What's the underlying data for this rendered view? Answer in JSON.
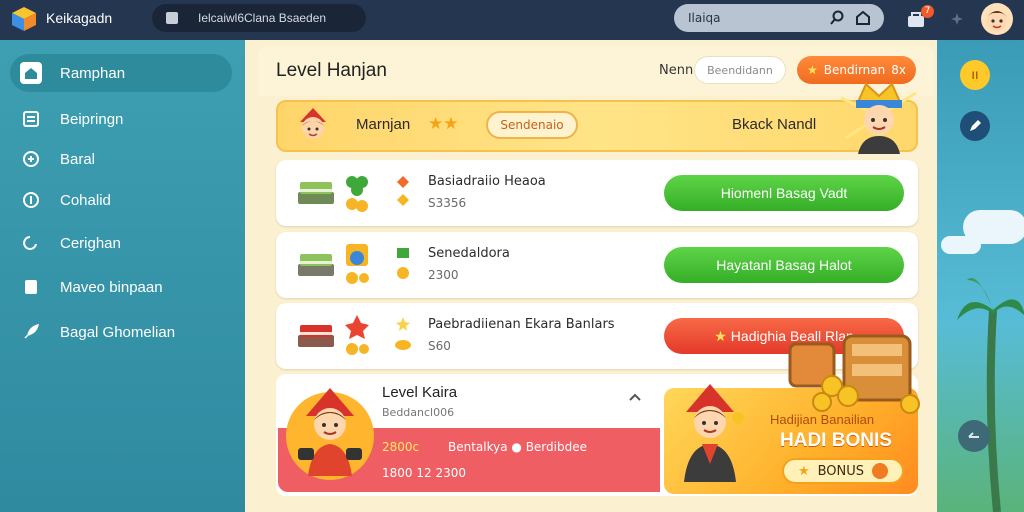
{
  "app": {
    "name": "Keikagadn",
    "tab": "Ielcaiwl6Clana Bsaeden"
  },
  "search": {
    "value": "Ilaiqa"
  },
  "header": {
    "badge_count": "7"
  },
  "sidebar": {
    "items": [
      {
        "label": "Ramphan",
        "icon": "home-icon",
        "active": true
      },
      {
        "label": "Beipringn",
        "icon": "list-icon"
      },
      {
        "label": "Baral",
        "icon": "gift-icon"
      },
      {
        "label": "Cohalid",
        "icon": "info-icon"
      },
      {
        "label": "Cerighan",
        "icon": "refresh-icon"
      },
      {
        "label": "Maveo binpaan",
        "icon": "note-icon"
      },
      {
        "label": "Bagal Ghomelian",
        "icon": "rocket-icon"
      }
    ]
  },
  "main": {
    "title": "Level Hanjan",
    "name_label": "Nenn",
    "name_placeholder": "Beendidann",
    "header_button": "Bendirnan",
    "header_button_suffix": "8x",
    "banner": {
      "name": "Marnjan",
      "stars": "★★",
      "button": "Sendenaio",
      "right_text": "Bkack Nandl"
    },
    "rows": [
      {
        "title": "Basiadraiio Heaoa",
        "value": "S3356",
        "button": "Hiomenl Basag Vadt",
        "style": "green"
      },
      {
        "title": "Senedaldora",
        "value": "2300",
        "button": "Hayatanl Basag Halot",
        "style": "green"
      },
      {
        "title": "Paebradiienan Ekara Banlars",
        "value": "S60",
        "button": "Hadighia Beall Rlan",
        "style": "red"
      }
    ],
    "level_card": {
      "title": "Level Kaira",
      "subtitle": "Beddancl006",
      "line1_highlight": "2800c",
      "line1_text": "Bentalkya ● Berdibdee",
      "line2": "1800 12 2300"
    },
    "bonus_card": {
      "subtitle": "Hadijian Banailian",
      "title": "HADI BONIS",
      "button": "BONUS"
    }
  },
  "colors": {
    "topbar": "#243650",
    "sidebar": "#3e9fb2",
    "panel": "#fbf0cf",
    "green": "#3bb42e",
    "red": "#e94530",
    "orange": "#f47a28"
  }
}
